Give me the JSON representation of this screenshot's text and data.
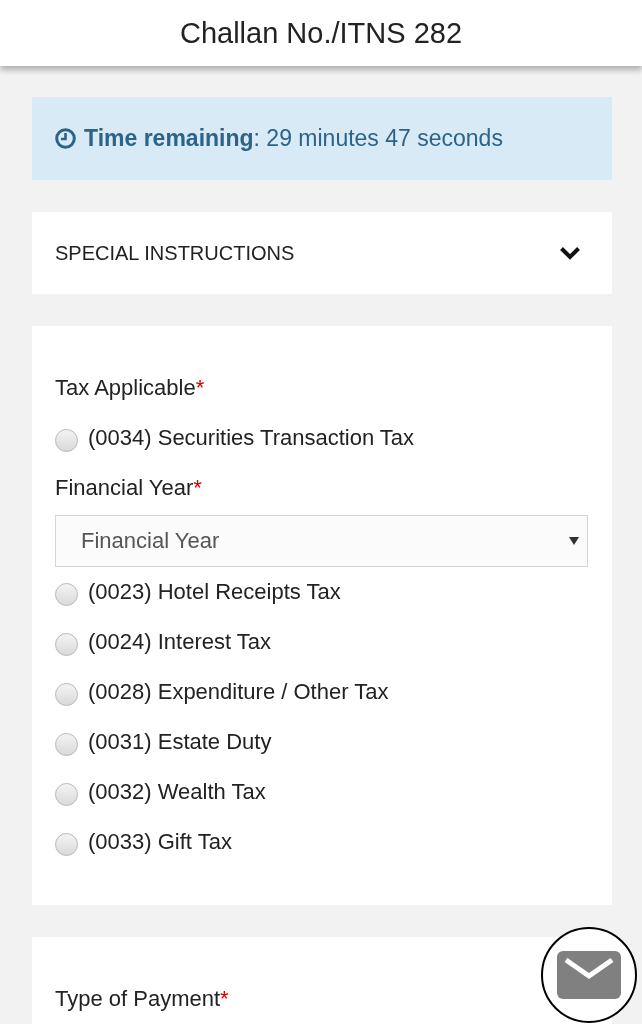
{
  "header": {
    "title": "Challan No./ITNS 282"
  },
  "timer": {
    "text": "**Time remaining**: 29 minutes 47 seconds"
  },
  "special_instructions": {
    "title": "SPECIAL INSTRUCTIONS",
    "expanded": false
  },
  "cards": [
    {
      "fields": [
        {
          "kind": "label",
          "text": "Tax Applicable",
          "required_mark": "*"
        },
        {
          "kind": "radio",
          "text": "(0034) Securities Transaction Tax",
          "selected": false
        },
        {
          "kind": "label",
          "text": "Financial Year",
          "required_mark": "*"
        },
        {
          "kind": "select",
          "placeholder": "Financial Year"
        },
        {
          "kind": "radio",
          "text": "(0023) Hotel Receipts Tax",
          "selected": false
        },
        {
          "kind": "radio",
          "text": "(0024) Interest Tax",
          "selected": false
        },
        {
          "kind": "radio",
          "text": "(0028) Expenditure / Other Tax",
          "selected": false
        },
        {
          "kind": "radio",
          "text": "(0031) Estate Duty",
          "selected": false
        },
        {
          "kind": "radio",
          "text": "(0032) Wealth Tax",
          "selected": false
        },
        {
          "kind": "radio",
          "text": "(0033) Gift Tax",
          "selected": false
        }
      ]
    },
    {
      "fields": [
        {
          "kind": "label",
          "text": "Type of Payment",
          "required_mark": "*"
        }
      ]
    }
  ]
}
